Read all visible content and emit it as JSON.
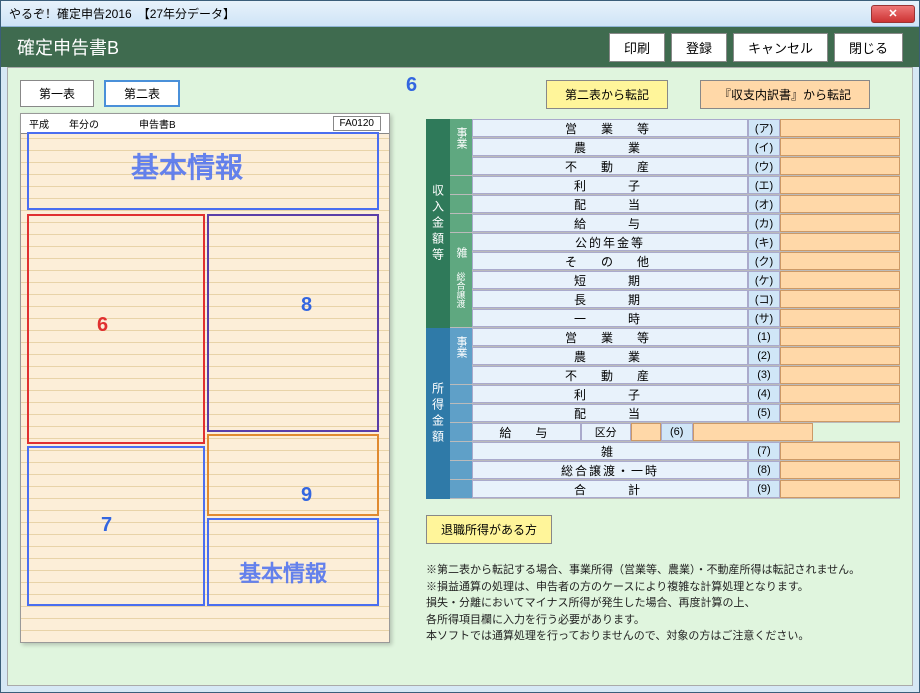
{
  "window": {
    "title": "やるぞ！確定申告2016　【27年分データ】"
  },
  "header": {
    "title": "確定申告書B",
    "buttons": {
      "print": "印刷",
      "save": "登録",
      "cancel": "キャンセル",
      "close": "閉じる"
    }
  },
  "tabs": {
    "first": "第一表",
    "second": "第二表"
  },
  "form_preview": {
    "heisei_label": "平成　　年分の",
    "form_name": "申告書B",
    "file_id": "FA0120",
    "overlay_basic": "基本情報",
    "overlay_basic2": "基本情報",
    "nums": {
      "n6": "6",
      "n7": "7",
      "n8": "8",
      "n9": "9"
    }
  },
  "transfer": {
    "from_table2": "第二表から転記",
    "from_breakdown": "『収支内訳書』から転記"
  },
  "marker6": "6",
  "income_section": {
    "label": "収入金額等",
    "groups": {
      "business": {
        "label": "事業",
        "rows": [
          {
            "label": "営　業　等",
            "mark": "(ア)"
          },
          {
            "label": "農　　業",
            "mark": "(イ)"
          }
        ]
      },
      "plain": [
        {
          "label": "不　動　産",
          "mark": "(ウ)"
        },
        {
          "label": "利　　子",
          "mark": "(エ)"
        },
        {
          "label": "配　　当",
          "mark": "(オ)"
        },
        {
          "label": "給　　与",
          "mark": "(カ)"
        }
      ],
      "misc": {
        "label": "雑",
        "rows": [
          {
            "label": "公的年金等",
            "mark": "(キ)"
          },
          {
            "label": "そ　の　他",
            "mark": "(ク)"
          }
        ]
      },
      "transfer": {
        "label": "総合譲渡",
        "rows": [
          {
            "label": "短　　期",
            "mark": "(ケ)"
          },
          {
            "label": "長　　期",
            "mark": "(コ)"
          }
        ]
      },
      "once": {
        "label": "一　　時",
        "mark": "(サ)"
      }
    }
  },
  "shotoku_section": {
    "label": "所得金額",
    "groups": {
      "business": {
        "label": "事業",
        "rows": [
          {
            "label": "営　業　等",
            "mark": "(1)"
          },
          {
            "label": "農　　業",
            "mark": "(2)"
          }
        ]
      },
      "plain": [
        {
          "label": "不　動　産",
          "mark": "(3)"
        },
        {
          "label": "利　　子",
          "mark": "(4)"
        },
        {
          "label": "配　　当",
          "mark": "(5)"
        }
      ],
      "salary": {
        "label": "給　与",
        "kubun": "区分",
        "mark": "(6)"
      },
      "tail": [
        {
          "label": "雑",
          "mark": "(7)"
        },
        {
          "label": "総合譲渡・一時",
          "mark": "(8)"
        },
        {
          "label": "合　　計",
          "mark": "(9)"
        }
      ]
    }
  },
  "retire_btn": "退職所得がある方",
  "notes": [
    "※第二表から転記する場合、事業所得（営業等、農業）・不動産所得は転記されません。",
    "※損益通算の処理は、申告者の方のケースにより複雑な計算処理となります。",
    "損失・分離においてマイナス所得が発生した場合、再度計算の上、",
    "各所得項目欄に入力を行う必要があります。",
    "本ソフトでは通算処理を行っておりませんので、対象の方はご注意ください。"
  ]
}
